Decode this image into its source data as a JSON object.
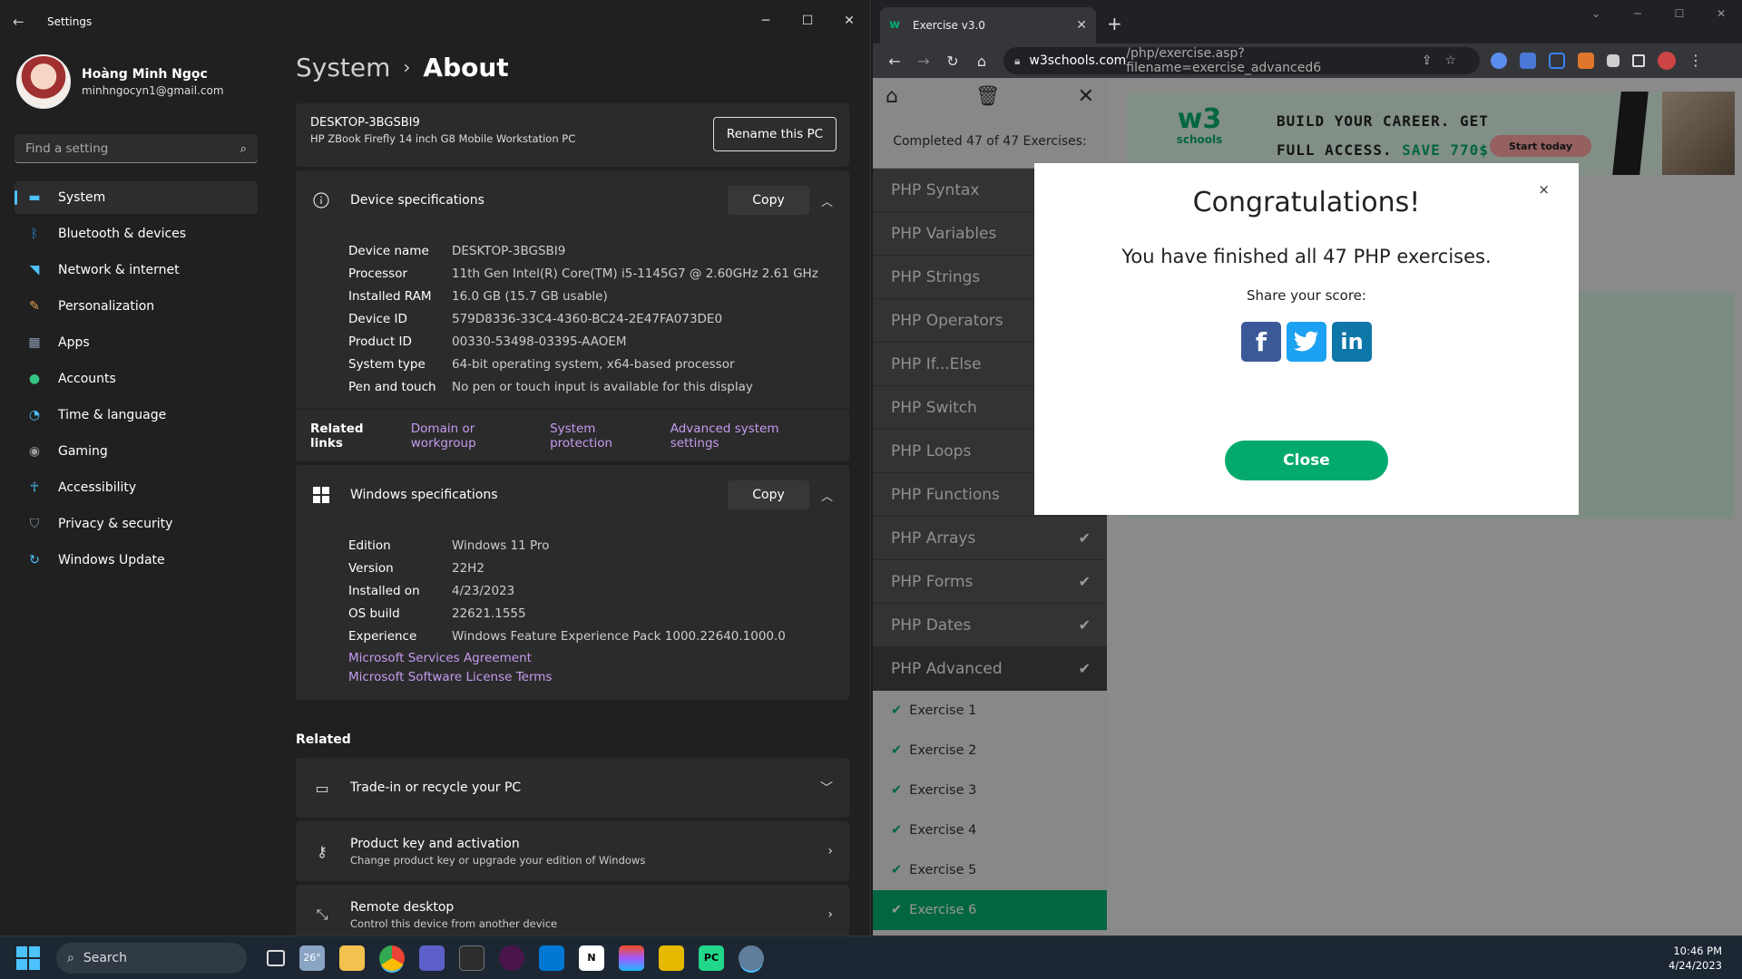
{
  "settings": {
    "window_title": "Settings",
    "profile": {
      "name": "Hoàng Minh Ngọc",
      "email": "minhngocyn1@gmail.com"
    },
    "search_placeholder": "Find a setting",
    "nav": [
      {
        "label": "System",
        "icon": "monitor-icon",
        "color": "#4cc2ff",
        "selected": true
      },
      {
        "label": "Bluetooth & devices",
        "icon": "bluetooth-icon",
        "color": "#2b88d8"
      },
      {
        "label": "Network & internet",
        "icon": "wifi-icon",
        "color": "#4cc2ff"
      },
      {
        "label": "Personalization",
        "icon": "brush-icon",
        "color": "#e8a15b"
      },
      {
        "label": "Apps",
        "icon": "apps-icon",
        "color": "#8a9bb0"
      },
      {
        "label": "Accounts",
        "icon": "person-icon",
        "color": "#33c481"
      },
      {
        "label": "Time & language",
        "icon": "globe-clock-icon",
        "color": "#4cc2ff"
      },
      {
        "label": "Gaming",
        "icon": "gamepad-icon",
        "color": "#999999"
      },
      {
        "label": "Accessibility",
        "icon": "accessibility-icon",
        "color": "#4cc2ff"
      },
      {
        "label": "Privacy & security",
        "icon": "shield-icon",
        "color": "#8a9bb0"
      },
      {
        "label": "Windows Update",
        "icon": "update-icon",
        "color": "#4cc2ff"
      }
    ],
    "breadcrumb": {
      "parent": "System",
      "separator": "›",
      "current": "About"
    },
    "pc": {
      "name": "DESKTOP-3BGSBI9",
      "model": "HP ZBook Firefly 14 inch G8 Mobile Workstation PC",
      "rename_label": "Rename this PC"
    },
    "device_specs": {
      "title": "Device specifications",
      "copy_label": "Copy",
      "rows": [
        {
          "k": "Device name",
          "v": "DESKTOP-3BGSBI9"
        },
        {
          "k": "Processor",
          "v": "11th Gen Intel(R) Core(TM) i5-1145G7 @ 2.60GHz   2.61 GHz"
        },
        {
          "k": "Installed RAM",
          "v": "16.0 GB (15.7 GB usable)"
        },
        {
          "k": "Device ID",
          "v": "579D8336-33C4-4360-BC24-2E47FA073DE0"
        },
        {
          "k": "Product ID",
          "v": "00330-53498-03395-AAOEM"
        },
        {
          "k": "System type",
          "v": "64-bit operating system, x64-based processor"
        },
        {
          "k": "Pen and touch",
          "v": "No pen or touch input is available for this display"
        }
      ]
    },
    "related_links": {
      "label": "Related links",
      "links": [
        "Domain or workgroup",
        "System protection",
        "Advanced system settings"
      ]
    },
    "windows_specs": {
      "title": "Windows specifications",
      "copy_label": "Copy",
      "rows": [
        {
          "k": "Edition",
          "v": "Windows 11 Pro"
        },
        {
          "k": "Version",
          "v": "22H2"
        },
        {
          "k": "Installed on",
          "v": "4/23/2023"
        },
        {
          "k": "OS build",
          "v": "22621.1555"
        },
        {
          "k": "Experience",
          "v": "Windows Feature Experience Pack 1000.22640.1000.0"
        }
      ],
      "links": [
        "Microsoft Services Agreement",
        "Microsoft Software License Terms"
      ]
    },
    "related": {
      "heading": "Related",
      "items": [
        {
          "title": "Trade-in or recycle your PC",
          "sub": ""
        },
        {
          "title": "Product key and activation",
          "sub": "Change product key or upgrade your edition of Windows"
        },
        {
          "title": "Remote desktop",
          "sub": "Control this device from another device"
        }
      ]
    }
  },
  "browser": {
    "tab_title": "Exercise v3.0",
    "url_host": "w3schools.com",
    "url_path": "/php/exercise.asp?filename=exercise_advanced6",
    "sidebar": {
      "completed": "Completed 47 of 47 Exercises:",
      "sections": [
        {
          "label": "PHP Syntax",
          "done": false
        },
        {
          "label": "PHP Variables",
          "done": false
        },
        {
          "label": "PHP Strings",
          "done": false
        },
        {
          "label": "PHP Operators",
          "done": false
        },
        {
          "label": "PHP If...Else",
          "done": false
        },
        {
          "label": "PHP Switch",
          "done": false
        },
        {
          "label": "PHP Loops",
          "done": false
        },
        {
          "label": "PHP Functions",
          "done": false
        },
        {
          "label": "PHP Arrays",
          "done": true
        },
        {
          "label": "PHP Forms",
          "done": true
        },
        {
          "label": "PHP Dates",
          "done": true
        },
        {
          "label": "PHP Advanced",
          "done": true
        }
      ],
      "exercises": [
        "Exercise 1",
        "Exercise 2",
        "Exercise 3",
        "Exercise 4",
        "Exercise 5",
        "Exercise 6"
      ],
      "active_exercise": "Exercise 6"
    },
    "ad": {
      "logo_mark": "w3",
      "logo_text": "schools",
      "line1": "BUILD YOUR CAREER. GET",
      "line2": "FULL ACCESS.",
      "save": "SAVE 770$",
      "cta": "Start today"
    },
    "modal": {
      "close_x": "×",
      "title": "Congratulations!",
      "message": "You have finished all 47 PHP exercises.",
      "share": "Share your score:",
      "close_label": "Close"
    }
  },
  "taskbar": {
    "search_label": "Search",
    "weather": "26°",
    "time": "10:46 PM",
    "date": "4/24/2023"
  }
}
